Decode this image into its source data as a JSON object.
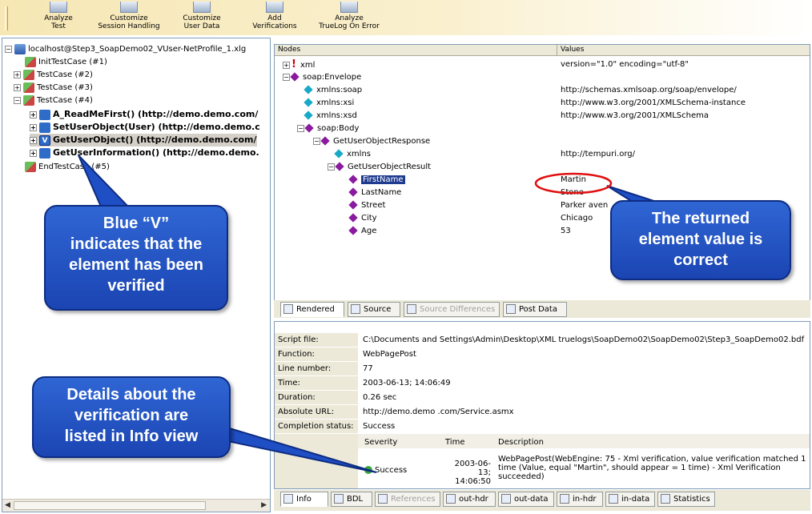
{
  "toolbar": {
    "buttons": [
      {
        "line1": "Analyze",
        "line2": "Test"
      },
      {
        "line1": "Customize",
        "line2": "Session Handling"
      },
      {
        "line1": "Customize",
        "line2": "User Data"
      },
      {
        "line1": "Add",
        "line2": "Verifications"
      },
      {
        "line1": "Analyze",
        "line2": "TrueLog On Error"
      }
    ]
  },
  "tree": {
    "items": [
      {
        "label": "localhost@Step3_SoapDemo02_VUser-NetProfile_1.xlg"
      },
      {
        "label": "InitTestCase (#1)"
      },
      {
        "label": "TestCase (#2)"
      },
      {
        "label": "TestCase (#3)"
      },
      {
        "label": "TestCase (#4)"
      },
      {
        "label": "A_ReadMeFirst() (http://demo.demo.com/"
      },
      {
        "label": "SetUserObject(User) (http://demo.demo.c"
      },
      {
        "label": "GetUserObject() (http://demo.demo.com/"
      },
      {
        "label": "GetUserInformation() (http://demo.demo."
      },
      {
        "label": "EndTestCase (#5)"
      }
    ]
  },
  "xml": {
    "col_nodes": "Nodes",
    "col_values": "Values",
    "rows": [
      {
        "node": "xml",
        "value": "version=\"1.0\" encoding=\"utf-8\""
      },
      {
        "node": "soap:Envelope",
        "value": ""
      },
      {
        "node": "xmlns:soap",
        "value": "http://schemas.xmlsoap.org/soap/envelope/"
      },
      {
        "node": "xmlns:xsi",
        "value": "http://www.w3.org/2001/XMLSchema-instance"
      },
      {
        "node": "xmlns:xsd",
        "value": "http://www.w3.org/2001/XMLSchema"
      },
      {
        "node": "soap:Body",
        "value": ""
      },
      {
        "node": "GetUserObjectResponse",
        "value": ""
      },
      {
        "node": "xmlns",
        "value": "http://tempuri.org/"
      },
      {
        "node": "GetUserObjectResult",
        "value": ""
      },
      {
        "node": "FirstName",
        "value": "Martin"
      },
      {
        "node": "LastName",
        "value": "Stone"
      },
      {
        "node": "Street",
        "value": "Parker aven"
      },
      {
        "node": "City",
        "value": "Chicago"
      },
      {
        "node": "Age",
        "value": "53"
      }
    ]
  },
  "view_tabs": [
    "Rendered",
    "Source",
    "Source Differences",
    "Post Data"
  ],
  "info": {
    "rows": [
      {
        "label": "Script file:",
        "value": "C:\\Documents and Settings\\Admin\\Desktop\\XML truelogs\\SoapDemo02\\SoapDemo02\\Step3_SoapDemo02.bdf"
      },
      {
        "label": "Function:",
        "value": "WebPagePost"
      },
      {
        "label": "Line number:",
        "value": "77"
      },
      {
        "label": "Time:",
        "value": "2003-06-13; 14:06:49"
      },
      {
        "label": "Duration:",
        "value": "0.26 sec"
      },
      {
        "label": "Absolute URL:",
        "value": "http://demo.demo .com/Service.asmx"
      },
      {
        "label": "Completion status:",
        "value": "Success"
      }
    ],
    "ver_headers": {
      "severity": "Severity",
      "time": "Time",
      "description": "Description"
    },
    "verification": {
      "severity": "Success",
      "time_1": "2003-06-13;",
      "time_2": "14:06:50",
      "desc_1": "WebPagePost(WebEngine: 75 - Xml verification, value verification matched 1",
      "desc_2": "time (Value, equal \"Martin\", should appear = 1 time) - Xml Verification",
      "desc_3": "succeeded)"
    }
  },
  "bottom_tabs": [
    "Info",
    "BDL",
    "References",
    "out-hdr",
    "out-data",
    "in-hdr",
    "in-data",
    "Statistics"
  ],
  "callouts": {
    "verified": [
      "Blue “V”",
      "indicates that the",
      "element has been",
      "verified"
    ],
    "details": [
      "Details about the",
      "verification are",
      "listed in Info view"
    ],
    "returned": [
      "The returned",
      "element value is",
      "correct"
    ]
  },
  "colors": {
    "callout_blue": "#1f4fc4",
    "highlight_red": "#e01010",
    "selection": "#1f3b8f"
  }
}
